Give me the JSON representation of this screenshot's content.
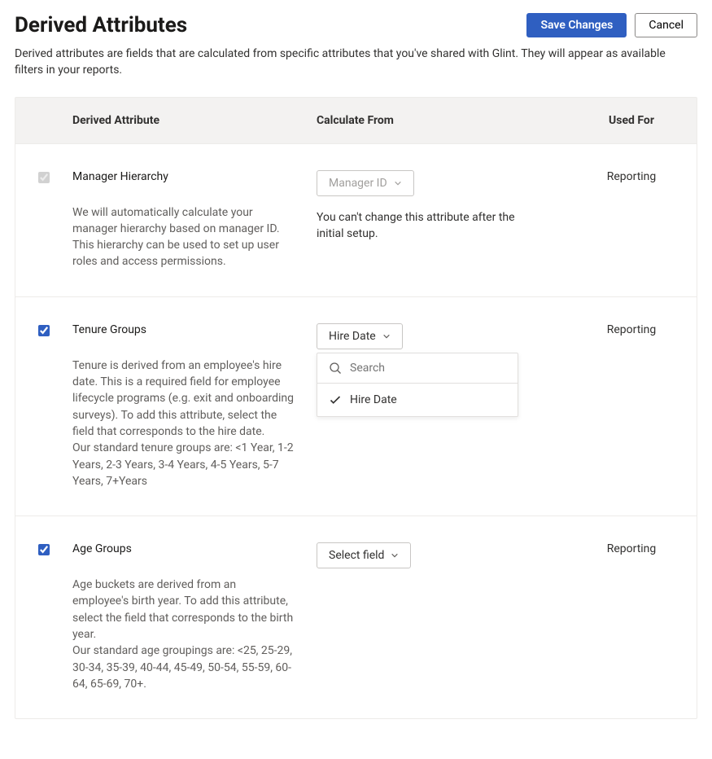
{
  "header": {
    "title": "Derived Attributes",
    "save_label": "Save Changes",
    "cancel_label": "Cancel",
    "description": "Derived attributes are fields that are calculated from specific attributes that you've shared with Glint. They will appear as available filters in your reports."
  },
  "columns": {
    "attribute": "Derived Attribute",
    "calculate": "Calculate From",
    "used": "Used For"
  },
  "rows": [
    {
      "title": "Manager Hierarchy",
      "description": "We will automatically calculate your manager hierarchy based on manager ID. This hierarchy can be used to set up user roles and access permissions.",
      "calc_label": "Manager ID",
      "helper": "You can't change this attribute after the initial setup.",
      "used": "Reporting"
    },
    {
      "title": "Tenure Groups",
      "description": "Tenure is derived from an employee's hire date. This is a required field for employee lifecycle programs (e.g. exit and onboarding surveys). To add this attribute, select the field that corresponds to the hire date.\nOur standard tenure groups are: <1 Year, 1-2 Years, 2-3 Years, 3-4 Years, 4-5 Years, 5-7 Years, 7+Years",
      "calc_label": "Hire Date",
      "used": "Reporting",
      "dropdown": {
        "search_placeholder": "Search",
        "option": "Hire Date"
      }
    },
    {
      "title": "Age Groups",
      "description": "Age buckets are derived from an employee's birth year. To add this attribute, select the field that corresponds to the birth year.\nOur standard age groupings are: <25, 25-29, 30-34, 35-39, 40-44, 45-49, 50-54, 55-59, 60-64, 65-69, 70+.",
      "calc_label": "Select field",
      "used": "Reporting"
    }
  ]
}
